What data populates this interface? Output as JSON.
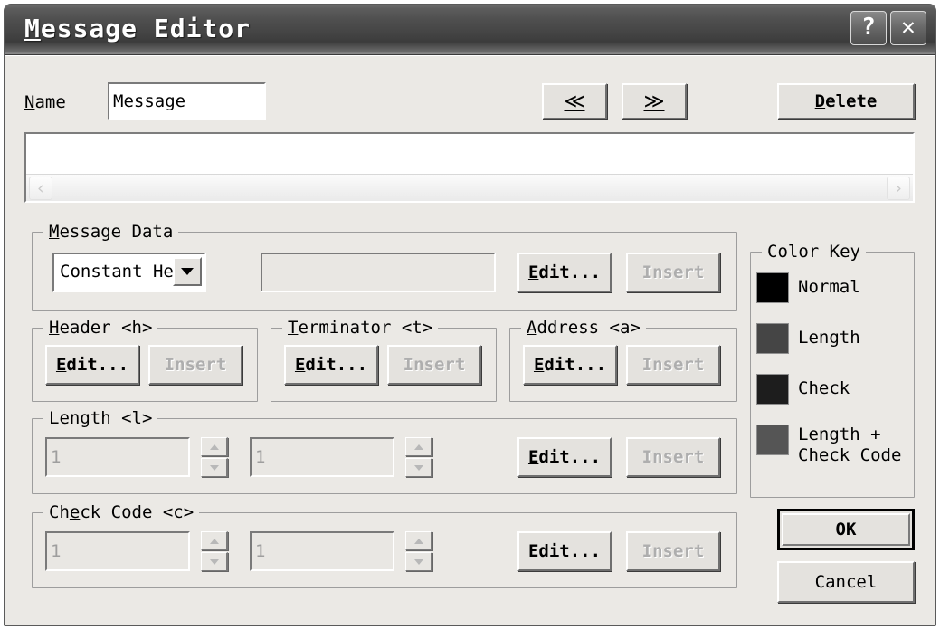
{
  "window": {
    "title_mnemonic": "M",
    "title_rest": "essage Editor",
    "help_button": "?",
    "close_button": "✕"
  },
  "name_row": {
    "label_mnemonic": "N",
    "label_rest": "ame",
    "value": "Message",
    "prev_button": "≪",
    "next_button": "≫",
    "delete_mnemonic": "D",
    "delete_rest": "elete"
  },
  "display": {
    "content": "",
    "scroll_left": "‹",
    "scroll_right": "›"
  },
  "message_data": {
    "title_mnemonic": "M",
    "title_rest": "essage Data",
    "combo_value": "Constant Hex",
    "combo_options": [
      "Constant Hex"
    ],
    "text_value": "",
    "edit_mnemonic": "E",
    "edit_rest": "dit...",
    "insert_label": "Insert"
  },
  "header": {
    "title_mnemonic": "H",
    "title_rest": "eader <h>",
    "edit_mnemonic": "E",
    "edit_rest": "dit...",
    "insert_label": "Insert"
  },
  "terminator": {
    "title_mnemonic": "T",
    "title_rest": "erminator <t>",
    "edit_mnemonic": "E",
    "edit_rest": "dit...",
    "insert_label": "Insert"
  },
  "address": {
    "title_mnemonic": "A",
    "title_rest": "ddress <a>",
    "edit_mnemonic": "E",
    "edit_rest": "dit...",
    "insert_label": "Insert"
  },
  "length": {
    "title_mnemonic": "L",
    "title_rest": "ength <l>",
    "field1_value": "1",
    "field2_value": "1",
    "edit_mnemonic": "E",
    "edit_rest": "dit...",
    "insert_label": "Insert"
  },
  "check_code": {
    "title_pre": "Ch",
    "title_mnemonic": "e",
    "title_rest": "ck Code <c>",
    "field1_value": "1",
    "field2_value": "1",
    "edit_mnemonic": "E",
    "edit_rest": "dit...",
    "insert_label": "Insert"
  },
  "color_key": {
    "title": "Color Key",
    "items": [
      {
        "label": "Normal",
        "color": "#000000"
      },
      {
        "label": "Length",
        "color": "#454545"
      },
      {
        "label": "Check",
        "color": "#1d1d1d"
      },
      {
        "label": "Length +\nCheck Code",
        "color": "#555555"
      }
    ]
  },
  "actions": {
    "ok_label": "OK",
    "cancel_label": "Cancel"
  }
}
